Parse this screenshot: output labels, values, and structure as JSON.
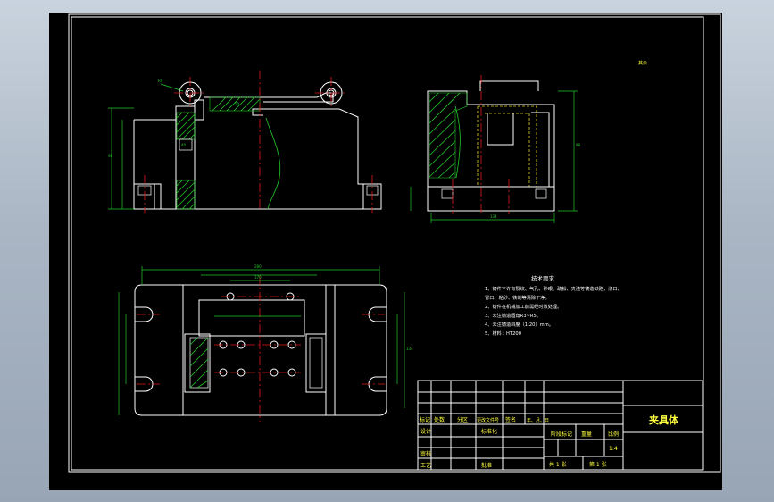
{
  "drawing": {
    "title": "夹具体",
    "scale": "1:4",
    "tech_requirements": {
      "heading": "技术要求",
      "items": [
        "1、铸件不许有裂纹、气孔、砂眼、疏松、夹渣等铸造缺陷，浇口、",
        "   冒口、粘砂、铁刺等清除干净。",
        "2、铸件在机械加工前需经时效处理。",
        "3、未注铸造圆角R3~R5。",
        "4、未注铸造斜度（1:20）mm。",
        "5、材料：HT200"
      ]
    },
    "title_block": {
      "row_labels": [
        "标记",
        "处数",
        "分区",
        "更改文件号",
        "签名",
        "年、月、日"
      ],
      "design_label": "设计",
      "standard_label": "标准化",
      "stage_label": "阶段标记",
      "weight_label": "重量",
      "scale_label": "比例",
      "review_label": "审核",
      "process_label": "工艺",
      "approve_label": "批准",
      "sheets_total": "共 1 张",
      "sheet_no": "第 1 张"
    },
    "annotation": "其余"
  },
  "colors": {
    "background": "#000000",
    "outline": "#ffffff",
    "dimension": "#22c82a",
    "centerline": "#e01818",
    "hidden": "#e0d21e",
    "frame_bg": "#aab6c4"
  }
}
